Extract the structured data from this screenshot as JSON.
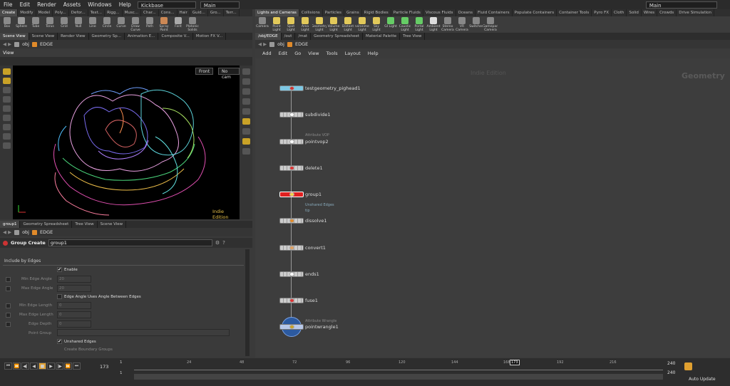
{
  "menu": [
    "File",
    "Edit",
    "Render",
    "Assets",
    "Windows",
    "Help"
  ],
  "desktop": "Kickbase",
  "context_main_left": "Main",
  "context_main_right": "Main",
  "shelf_left_tabs": [
    "Create",
    "Modify",
    "Model",
    "Poly...",
    "Defor...",
    "Text...",
    "Rigg...",
    "Musc...",
    "Char...",
    "Cons...",
    "Hair",
    "Guid...",
    "Gro...",
    "Terr..."
  ],
  "shelf_left_tools": [
    {
      "label": "Box",
      "color": "#8a8a8a"
    },
    {
      "label": "Sphere",
      "color": "#9a9a9a"
    },
    {
      "label": "Tube",
      "color": "#8a8a8a"
    },
    {
      "label": "Torus",
      "color": "#8a8a8a"
    },
    {
      "label": "Grid",
      "color": "#8a8a8a"
    },
    {
      "label": "Null",
      "color": "#8a8a8a"
    },
    {
      "label": "Line",
      "color": "#8a8a8a"
    },
    {
      "label": "Circle",
      "color": "#8a8a8a"
    },
    {
      "label": "Curve",
      "color": "#8a8a8a"
    },
    {
      "label": "Draw Curve",
      "color": "#8a8a8a"
    },
    {
      "label": "Path",
      "color": "#8a8a8a"
    },
    {
      "label": "Spray Paint",
      "color": "#c85"
    },
    {
      "label": "Font",
      "color": "#aaa"
    },
    {
      "label": "Platonic Solids",
      "color": "#888"
    }
  ],
  "shelf_right_tabs": [
    "Lights and Cameras",
    "Collisions",
    "Particles",
    "Grains",
    "Rigid Bodies",
    "Particle Fluids",
    "Viscous Fluids",
    "Oceans",
    "Fluid Containers",
    "Populate Containers",
    "Container Tools",
    "Pyro FX",
    "Cloth",
    "Solid",
    "Wires",
    "Crowds",
    "Drive Simulation"
  ],
  "shelf_right_tools": [
    {
      "label": "Camera",
      "color": "#888"
    },
    {
      "label": "Point Light",
      "color": "#e2c95a"
    },
    {
      "label": "Spot Light",
      "color": "#e2c95a"
    },
    {
      "label": "Area Light",
      "color": "#e2c95a"
    },
    {
      "label": "Geometry Light",
      "color": "#e2c95a"
    },
    {
      "label": "Volume Light",
      "color": "#e2c95a"
    },
    {
      "label": "Distant Light",
      "color": "#e2c95a"
    },
    {
      "label": "Environment Light",
      "color": "#e2c95a"
    },
    {
      "label": "Sky Light",
      "color": "#e2c95a"
    },
    {
      "label": "GI Light",
      "color": "#6c6"
    },
    {
      "label": "Caustic Light",
      "color": "#6c6"
    },
    {
      "label": "Portal Light",
      "color": "#6c6"
    },
    {
      "label": "Ambient Light",
      "color": "#ddd"
    },
    {
      "label": "Stereo Camera",
      "color": "#888"
    },
    {
      "label": "VR Camera",
      "color": "#888"
    },
    {
      "label": "Switcher",
      "color": "#888"
    },
    {
      "label": "Gamepad Camera",
      "color": "#888"
    }
  ],
  "viewer_tabs": [
    "Scene View",
    "Scene View",
    "Render View",
    "Geometry Sp...",
    "Animation E...",
    "Composite V...",
    "Motion FX V..."
  ],
  "viewer_path": {
    "obj": "obj",
    "node": "EDGE"
  },
  "view_label": "View",
  "view_front": "Front",
  "view_cam": "No cam",
  "indie_viewport": "Indie Edition",
  "param_tabs": [
    "group1",
    "Geometry Spreadsheet",
    "Tree View",
    "Scene View"
  ],
  "param_path": {
    "obj": "obj",
    "node": "EDGE"
  },
  "param_header": {
    "type": "Group Create",
    "name": "group1"
  },
  "section_title": "Include by Edges",
  "params": {
    "enable": "Enable",
    "min_angle": "Min Edge Angle",
    "min_angle_val": "20",
    "max_angle": "Max Edge Angle",
    "max_angle_val": "20",
    "edge_angle_between": "Edge Angle Uses Angle Between Edges",
    "min_len": "Min Edge Length",
    "min_len_val": "0",
    "max_len": "Max Edge Length",
    "max_len_val": "0",
    "edge_depth": "Edge Depth",
    "edge_depth_val": "0",
    "point_group": "Point Group",
    "unshared": "Unshared Edges",
    "boundary": "Create Boundary Groups"
  },
  "net_tabs": [
    "/obj/EDGE",
    "/out",
    "/mat",
    "Geometry Spreadsheet",
    "Material Palette",
    "Tree View"
  ],
  "net_path": {
    "obj": "obj",
    "node": "EDGE"
  },
  "net_menu": [
    "Add",
    "Edit",
    "Go",
    "View",
    "Tools",
    "Layout",
    "Help"
  ],
  "net_watermark": "Indie Edition",
  "net_context": "Geometry",
  "nodes": [
    {
      "name": "testgeometry_pighead1",
      "sub": "",
      "color": "#7ec8e3"
    },
    {
      "name": "subdivide1",
      "sub": ""
    },
    {
      "name": "pointvop2",
      "sub": "Attribute VOP"
    },
    {
      "name": "delete1",
      "sub": ""
    },
    {
      "name": "group1",
      "sub": "",
      "color": "#e02020"
    },
    {
      "name": "dissolve1",
      "sub": ""
    },
    {
      "name": "convert1",
      "sub": ""
    },
    {
      "name": "ends1",
      "sub": ""
    },
    {
      "name": "fuse1",
      "sub": ""
    },
    {
      "name": "pointwrangle1",
      "sub": "Attribute Wrangle"
    }
  ],
  "group_comment": {
    "line1": "Unshared Edges",
    "line2": "tip"
  },
  "timeline": {
    "frame": "173",
    "start": "1",
    "end_start": "1",
    "ticks": [
      "24",
      "48",
      "72",
      "96",
      "120",
      "144",
      "168",
      "192",
      "216"
    ],
    "current": "173",
    "end1": "240",
    "end2": "240",
    "auto_update": "Auto Update"
  }
}
